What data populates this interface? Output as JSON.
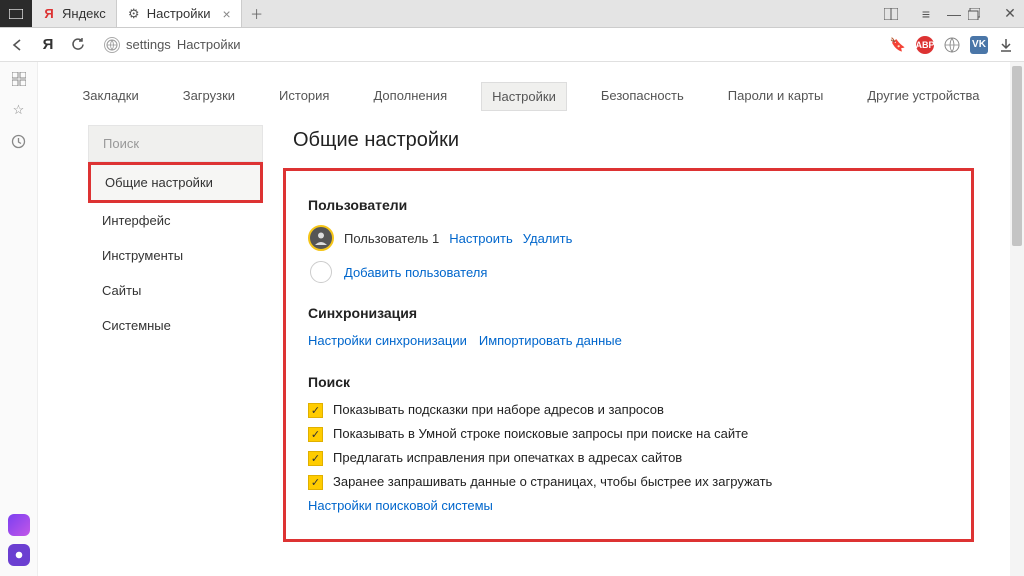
{
  "tabs": {
    "tab1": {
      "label": "Яндекс"
    },
    "tab2": {
      "label": "Настройки"
    }
  },
  "address": {
    "prefix": "settings",
    "text": "Настройки"
  },
  "topnav": {
    "bookmarks": "Закладки",
    "downloads": "Загрузки",
    "history": "История",
    "addons": "Дополнения",
    "settings": "Настройки",
    "security": "Безопасность",
    "passwords": "Пароли и карты",
    "devices": "Другие устройства"
  },
  "sidebar": {
    "search": "Поиск",
    "general": "Общие настройки",
    "interface": "Интерфейс",
    "tools": "Инструменты",
    "sites": "Сайты",
    "system": "Системные"
  },
  "main": {
    "title": "Общие настройки",
    "users": {
      "heading": "Пользователи",
      "user1": "Пользователь 1",
      "configure": "Настроить",
      "delete": "Удалить",
      "add": "Добавить пользователя"
    },
    "sync": {
      "heading": "Синхронизация",
      "settings": "Настройки синхронизации",
      "import": "Импортировать данные"
    },
    "search": {
      "heading": "Поиск",
      "opt1": "Показывать подсказки при наборе адресов и запросов",
      "opt2": "Показывать в Умной строке поисковые запросы при поиске на сайте",
      "opt3": "Предлагать исправления при опечатках в адресах сайтов",
      "opt4": "Заранее запрашивать данные о страницах, чтобы быстрее их загружать",
      "engine": "Настройки поисковой системы"
    }
  },
  "ext": {
    "abp": "ABP",
    "vk": "VK"
  }
}
